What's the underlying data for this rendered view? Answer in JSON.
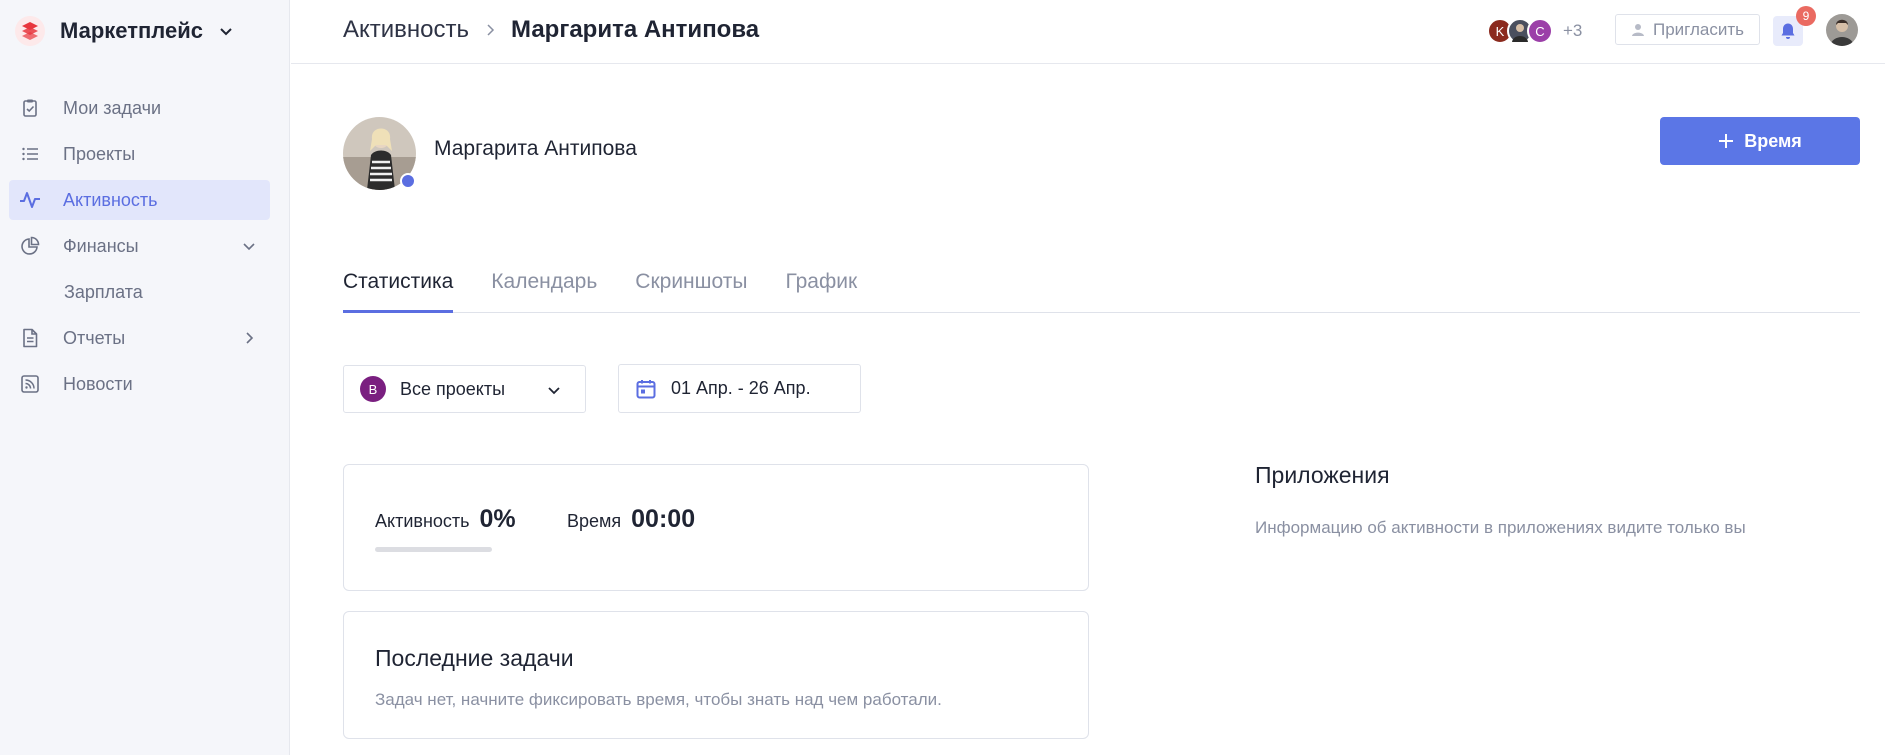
{
  "sidebar": {
    "workspace": "Маркетплейс",
    "items": [
      {
        "label": "Мои задачи",
        "icon": "clipboard-check-icon"
      },
      {
        "label": "Проекты",
        "icon": "list-icon"
      },
      {
        "label": "Активность",
        "icon": "activity-icon",
        "active": true
      },
      {
        "label": "Финансы",
        "icon": "pie-chart-icon",
        "expanded": true
      },
      {
        "label": "Зарплата"
      },
      {
        "label": "Отчеты",
        "icon": "document-icon"
      },
      {
        "label": "Новости",
        "icon": "rss-icon"
      }
    ]
  },
  "header": {
    "breadcrumb_parent": "Активность",
    "breadcrumb_current": "Маргарита Антипова",
    "avatars": [
      {
        "letter": "K",
        "color": "#8b2a1e"
      },
      {
        "letter": "",
        "color": "#4a4f5e"
      },
      {
        "letter": "C",
        "color": "#9b3fa8"
      }
    ],
    "more_count": "+3",
    "invite_label": "Пригласить",
    "notifications_count": "9"
  },
  "profile": {
    "name": "Маргарита Антипова",
    "add_time_label": "Время"
  },
  "tabs": [
    "Статистика",
    "Календарь",
    "Скриншоты",
    "График"
  ],
  "filters": {
    "project_badge": "B",
    "project_label": "Все проекты",
    "date_range": "01 Апр. - 26 Апр."
  },
  "stats": {
    "activity_label": "Активность",
    "activity_value": "0%",
    "activity_fraction": 0,
    "time_label": "Время",
    "time_value": "00:00"
  },
  "recent_tasks": {
    "title": "Последние задачи",
    "empty_text": "Задач нет, начните фиксировать время, чтобы знать над чем работали."
  },
  "apps": {
    "title": "Приложения",
    "note": "Информацию об активности в приложениях видите только вы"
  },
  "colors": {
    "accent": "#5b6ee1",
    "primary_button": "#5b76e6",
    "badge": "#ea6a61",
    "project_badge": "#7a1f80"
  }
}
